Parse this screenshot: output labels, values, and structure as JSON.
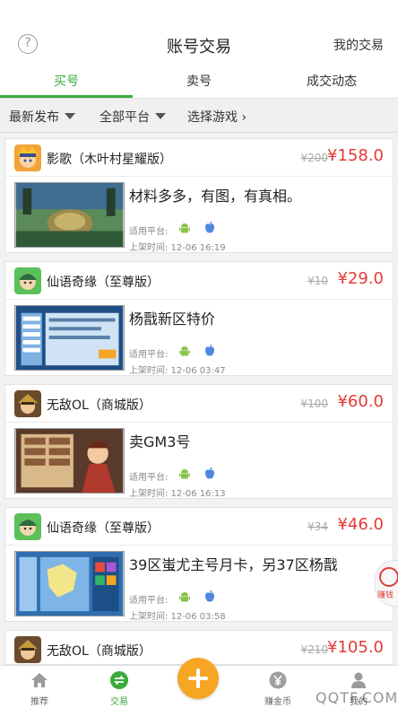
{
  "header": {
    "help_icon_glyph": "?",
    "title": "账号交易",
    "my_trade_label": "我的交易"
  },
  "tabs": [
    {
      "label": "买号",
      "active": true
    },
    {
      "label": "卖号",
      "active": false
    },
    {
      "label": "成交动态",
      "active": false
    }
  ],
  "filters": {
    "sort_label": "最新发布",
    "platform_label": "全部平台",
    "game_label": "选择游戏",
    "game_chevron": "›"
  },
  "listings": [
    {
      "avatar_icon": "naruto-avatar-icon",
      "title": "影歌（木叶村星耀版）",
      "original_price": "¥200",
      "price": "¥158.0",
      "description": "材料多多，有图，有真相。",
      "platform_label": "适用平台:",
      "list_time": "上架时间: 12-06 16:19"
    },
    {
      "avatar_icon": "xianyu-avatar-icon",
      "title": "仙语奇缘（至尊版）",
      "original_price": "¥10",
      "price": "¥29.0",
      "description": "杨戬新区特价",
      "platform_label": "适用平台:",
      "list_time": "上架时间: 12-06 03:47"
    },
    {
      "avatar_icon": "wudi-avatar-icon",
      "title": "无敌OL（商城版）",
      "original_price": "¥100",
      "price": "¥60.0",
      "description": "卖GM3号",
      "platform_label": "适用平台:",
      "list_time": "上架时间: 12-06 16:13"
    },
    {
      "avatar_icon": "xianyu-avatar-icon",
      "title": "仙语奇缘（至尊版）",
      "original_price": "¥34",
      "price": "¥46.0",
      "description": "39区蚩尤主号月卡，另37区杨戬",
      "platform_label": "适用平台:",
      "list_time": "上架时间: 12-06 03:58"
    },
    {
      "avatar_icon": "wudi-avatar-icon",
      "title": "无敌OL（商城版）",
      "original_price": "¥210",
      "price": "¥105.0"
    }
  ],
  "float_badge": {
    "label": "赚钱"
  },
  "tabbar": {
    "items": [
      {
        "label": "推荐",
        "icon": "home-icon",
        "active": false
      },
      {
        "label": "交易",
        "icon": "trade-icon",
        "active": true
      },
      {
        "label": "",
        "icon": "plus-icon",
        "active": false
      },
      {
        "label": "赚金币",
        "icon": "coin-icon",
        "active": false
      },
      {
        "label": "我的",
        "icon": "user-icon",
        "active": false
      }
    ]
  },
  "watermark": "QQTF.COM",
  "colors": {
    "accent_green": "#3bab3b",
    "price_red": "#e53935",
    "plus_orange": "#f6a623"
  }
}
